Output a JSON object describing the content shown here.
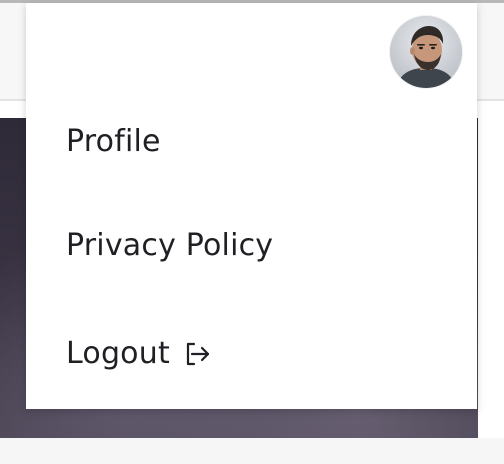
{
  "menu": {
    "items": [
      {
        "label": "Profile",
        "icon": null
      },
      {
        "label": "Privacy Policy",
        "icon": null
      },
      {
        "label": "Logout",
        "icon": "logout-icon"
      }
    ]
  },
  "user": {
    "avatar_icon": "user-avatar"
  },
  "colors": {
    "menu_text": "#1f1f24",
    "dropdown_bg": "#ffffff",
    "hero_bg": "#35303f"
  }
}
